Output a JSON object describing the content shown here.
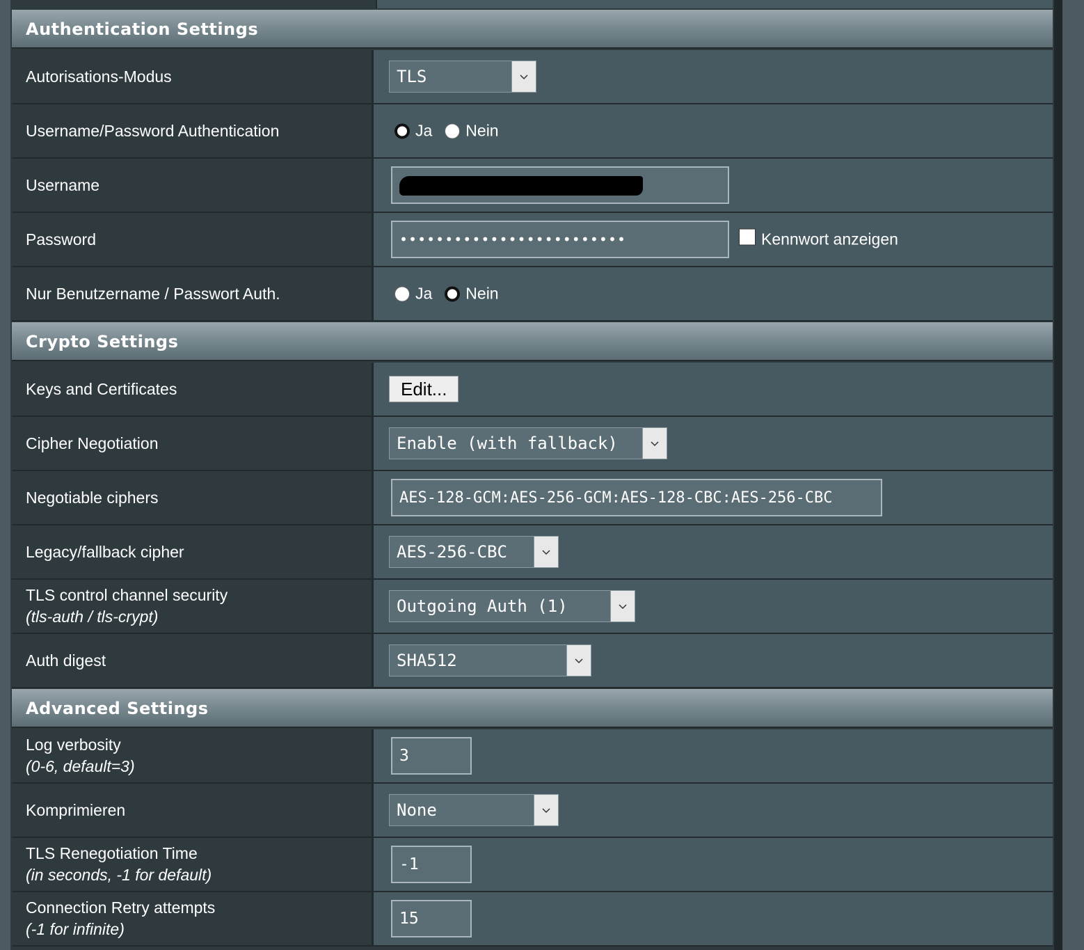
{
  "sections": {
    "auth": "Authentication Settings",
    "crypto": "Crypto Settings",
    "advanced": "Advanced Settings"
  },
  "auth": {
    "mode_label": "Autorisations-Modus",
    "mode_value": "TLS",
    "userpass_label": "Username/Password Authentication",
    "userpass_yes": "Ja",
    "userpass_no": "Nein",
    "userpass_selected": "Ja",
    "username_label": "Username",
    "password_label": "Password",
    "password_value": "•••••••••••••••••••••••••",
    "show_password_label": "Kennwort anzeigen",
    "show_password_checked": false,
    "only_userpass_label": "Nur Benutzername / Passwort Auth.",
    "only_userpass_yes": "Ja",
    "only_userpass_no": "Nein",
    "only_userpass_selected": "Nein"
  },
  "crypto": {
    "keys_label": "Keys and Certificates",
    "keys_button": "Edit...",
    "cipher_neg_label": "Cipher Negotiation",
    "cipher_neg_value": "Enable (with fallback)",
    "neg_ciphers_label": "Negotiable ciphers",
    "neg_ciphers_value": "AES-128-GCM:AES-256-GCM:AES-128-CBC:AES-256-CBC",
    "legacy_cipher_label": "Legacy/fallback cipher",
    "legacy_cipher_value": "AES-256-CBC",
    "tls_control_label": "TLS control channel security",
    "tls_control_hint": "(tls-auth / tls-crypt)",
    "tls_control_value": "Outgoing Auth (1)",
    "auth_digest_label": "Auth digest",
    "auth_digest_value": "SHA512"
  },
  "advanced": {
    "log_label": "Log verbosity",
    "log_hint": "(0-6, default=3)",
    "log_value": "3",
    "compress_label": "Komprimieren",
    "compress_value": "None",
    "reneg_label": "TLS Renegotiation Time",
    "reneg_hint": "(in seconds, -1 for default)",
    "reneg_value": "-1",
    "retry_label": "Connection Retry attempts",
    "retry_hint": "(-1 for infinite)",
    "retry_value": "15"
  }
}
